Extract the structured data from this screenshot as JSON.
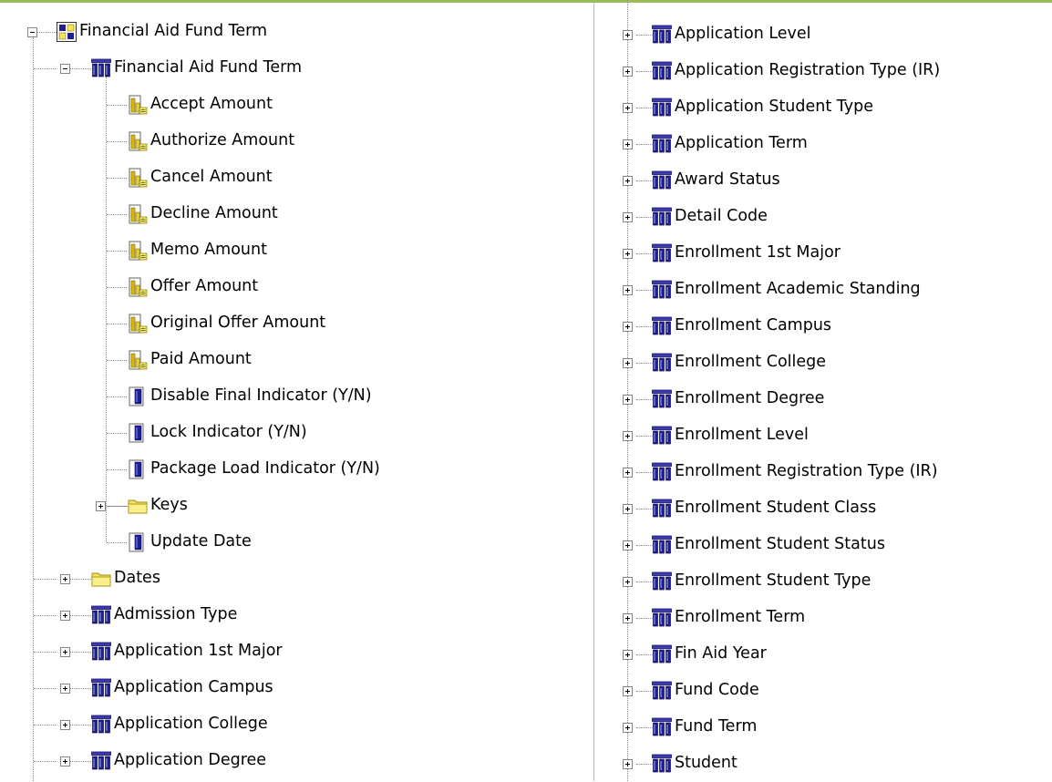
{
  "tree_left": [
    {
      "label": "Financial Aid Fund Term",
      "icon": "hierarchy-icon",
      "level": 0,
      "expander": "expanded",
      "name": "tree-node-financial-aid-fund-term-root"
    },
    {
      "label": "Financial Aid Fund Term",
      "icon": "dimension-icon",
      "level": 1,
      "expander": "expanded",
      "name": "tree-node-financial-aid-fund-term"
    },
    {
      "label": "Accept Amount",
      "icon": "measure-icon",
      "level": 2,
      "expander": "none",
      "name": "tree-node-accept-amount"
    },
    {
      "label": "Authorize Amount",
      "icon": "measure-icon",
      "level": 2,
      "expander": "none",
      "name": "tree-node-authorize-amount"
    },
    {
      "label": "Cancel Amount",
      "icon": "measure-icon",
      "level": 2,
      "expander": "none",
      "name": "tree-node-cancel-amount"
    },
    {
      "label": "Decline Amount",
      "icon": "measure-icon",
      "level": 2,
      "expander": "none",
      "name": "tree-node-decline-amount"
    },
    {
      "label": "Memo Amount",
      "icon": "measure-icon",
      "level": 2,
      "expander": "none",
      "name": "tree-node-memo-amount"
    },
    {
      "label": "Offer Amount",
      "icon": "measure-icon",
      "level": 2,
      "expander": "none",
      "name": "tree-node-offer-amount"
    },
    {
      "label": "Original Offer Amount",
      "icon": "measure-icon",
      "level": 2,
      "expander": "none",
      "name": "tree-node-original-offer-amount"
    },
    {
      "label": "Paid Amount",
      "icon": "measure-icon",
      "level": 2,
      "expander": "none",
      "name": "tree-node-paid-amount"
    },
    {
      "label": "Disable Final Indicator (Y/N)",
      "icon": "attribute-icon",
      "level": 2,
      "expander": "none",
      "name": "tree-node-disable-final-indicator"
    },
    {
      "label": "Lock Indicator (Y/N)",
      "icon": "attribute-icon",
      "level": 2,
      "expander": "none",
      "name": "tree-node-lock-indicator"
    },
    {
      "label": "Package Load Indicator (Y/N)",
      "icon": "attribute-icon",
      "level": 2,
      "expander": "none",
      "name": "tree-node-package-load-indicator"
    },
    {
      "label": "Keys",
      "icon": "folder-icon",
      "level": 2,
      "expander": "collapsed",
      "name": "tree-node-keys"
    },
    {
      "label": "Update Date",
      "icon": "attribute-icon",
      "level": 2,
      "expander": "none",
      "name": "tree-node-update-date"
    },
    {
      "label": "Dates",
      "icon": "folder-icon",
      "level": 1,
      "expander": "collapsed",
      "name": "tree-node-dates"
    },
    {
      "label": "Admission Type",
      "icon": "dimension-icon",
      "level": 1,
      "expander": "collapsed",
      "name": "tree-node-admission-type"
    },
    {
      "label": "Application 1st Major",
      "icon": "dimension-icon",
      "level": 1,
      "expander": "collapsed",
      "name": "tree-node-application-1st-major"
    },
    {
      "label": "Application Campus",
      "icon": "dimension-icon",
      "level": 1,
      "expander": "collapsed",
      "name": "tree-node-application-campus"
    },
    {
      "label": "Application College",
      "icon": "dimension-icon",
      "level": 1,
      "expander": "collapsed",
      "name": "tree-node-application-college"
    },
    {
      "label": "Application Degree",
      "icon": "dimension-icon",
      "level": 1,
      "expander": "collapsed",
      "name": "tree-node-application-degree"
    }
  ],
  "tree_right": [
    {
      "label": "Application Level",
      "icon": "dimension-icon",
      "name": "tree-node-application-level"
    },
    {
      "label": "Application Registration Type (IR)",
      "icon": "dimension-icon",
      "name": "tree-node-application-registration-type"
    },
    {
      "label": "Application Student Type",
      "icon": "dimension-icon",
      "name": "tree-node-application-student-type"
    },
    {
      "label": "Application Term",
      "icon": "dimension-icon",
      "name": "tree-node-application-term"
    },
    {
      "label": "Award Status",
      "icon": "dimension-icon",
      "name": "tree-node-award-status"
    },
    {
      "label": "Detail Code",
      "icon": "dimension-icon",
      "name": "tree-node-detail-code"
    },
    {
      "label": "Enrollment 1st Major",
      "icon": "dimension-icon",
      "name": "tree-node-enrollment-1st-major"
    },
    {
      "label": "Enrollment Academic Standing",
      "icon": "dimension-icon",
      "name": "tree-node-enrollment-academic-standing"
    },
    {
      "label": "Enrollment Campus",
      "icon": "dimension-icon",
      "name": "tree-node-enrollment-campus"
    },
    {
      "label": "Enrollment College",
      "icon": "dimension-icon",
      "name": "tree-node-enrollment-college"
    },
    {
      "label": "Enrollment Degree",
      "icon": "dimension-icon",
      "name": "tree-node-enrollment-degree"
    },
    {
      "label": "Enrollment Level",
      "icon": "dimension-icon",
      "name": "tree-node-enrollment-level"
    },
    {
      "label": "Enrollment Registration Type (IR)",
      "icon": "dimension-icon",
      "name": "tree-node-enrollment-registration-type"
    },
    {
      "label": "Enrollment Student Class",
      "icon": "dimension-icon",
      "name": "tree-node-enrollment-student-class"
    },
    {
      "label": "Enrollment Student Status",
      "icon": "dimension-icon",
      "name": "tree-node-enrollment-student-status"
    },
    {
      "label": "Enrollment Student Type",
      "icon": "dimension-icon",
      "name": "tree-node-enrollment-student-type"
    },
    {
      "label": "Enrollment Term",
      "icon": "dimension-icon",
      "name": "tree-node-enrollment-term"
    },
    {
      "label": "Fin Aid Year",
      "icon": "dimension-icon",
      "name": "tree-node-fin-aid-year"
    },
    {
      "label": "Fund Code",
      "icon": "dimension-icon",
      "name": "tree-node-fund-code"
    },
    {
      "label": "Fund Term",
      "icon": "dimension-icon",
      "name": "tree-node-fund-term"
    },
    {
      "label": "Student",
      "icon": "dimension-icon",
      "name": "tree-node-student"
    }
  ],
  "colors": {
    "top_rule": "#9bbb59",
    "dimension_blue": "#1f1f8f",
    "folder_yellow": "#f7e35a",
    "measure_gold": "#d6b800"
  }
}
